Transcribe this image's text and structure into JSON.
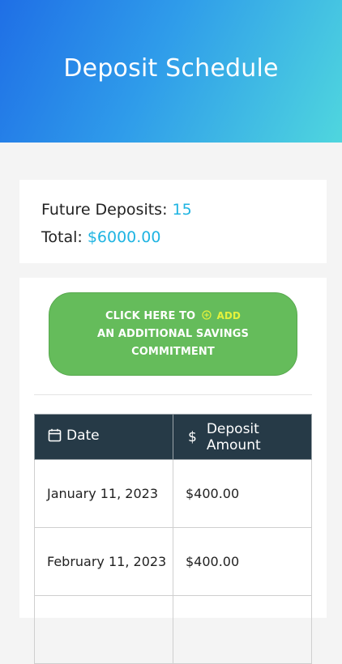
{
  "header": {
    "title": "Deposit Schedule"
  },
  "summary": {
    "future_label": "Future Deposits:",
    "future_value": "15",
    "total_label": "Total:",
    "total_value": "$6000.00"
  },
  "add_button": {
    "line1_prefix": "CLICK HERE TO",
    "line1_add": "ADD",
    "line2": "AN ADDITIONAL SAVINGS",
    "line3": "COMMITMENT",
    "icon": "plus-circle-icon"
  },
  "table": {
    "headers": {
      "date": "Date",
      "amount": "Deposit Amount"
    },
    "header_icons": {
      "date": "calendar-icon",
      "amount": "dollar-icon"
    },
    "rows": [
      {
        "date": "January 11, 2023",
        "amount": "$400.00"
      },
      {
        "date": "February 11, 2023",
        "amount": "$400.00"
      },
      {
        "date": "",
        "amount": ""
      }
    ]
  },
  "colors": {
    "header_gradient": [
      "#1f6fe6",
      "#4fd6de"
    ],
    "accent_value": "#1fb4e2",
    "button_green": "#65bc5b",
    "add_highlight": "#e4f23c",
    "table_header_bg": "#263a47"
  }
}
